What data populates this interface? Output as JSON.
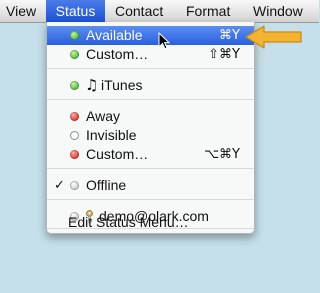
{
  "menubar": {
    "items": [
      {
        "label": "View"
      },
      {
        "label": "Status"
      },
      {
        "label": "Contact"
      },
      {
        "label": "Format"
      },
      {
        "label": "Window"
      }
    ]
  },
  "status_menu": {
    "available": {
      "label": "Available",
      "shortcut": "⌘Y"
    },
    "custom_available": {
      "label": "Custom…",
      "shortcut": "⇧⌘Y"
    },
    "itunes": {
      "label": "iTunes"
    },
    "away": {
      "label": "Away"
    },
    "invisible": {
      "label": "Invisible"
    },
    "custom_away": {
      "label": "Custom…",
      "shortcut": "⌥⌘Y"
    },
    "offline": {
      "label": "Offline",
      "checkmark": "✓"
    },
    "account": {
      "label": "demo@olark.com"
    },
    "edit": {
      "label": "Edit Status Menu…"
    }
  },
  "colors": {
    "desktop": "#c5e0ea",
    "highlight": "#2a5fe0",
    "arrow": "#f3b431",
    "available_dot": "#4fc23a",
    "away_dot": "#e23a2d"
  }
}
